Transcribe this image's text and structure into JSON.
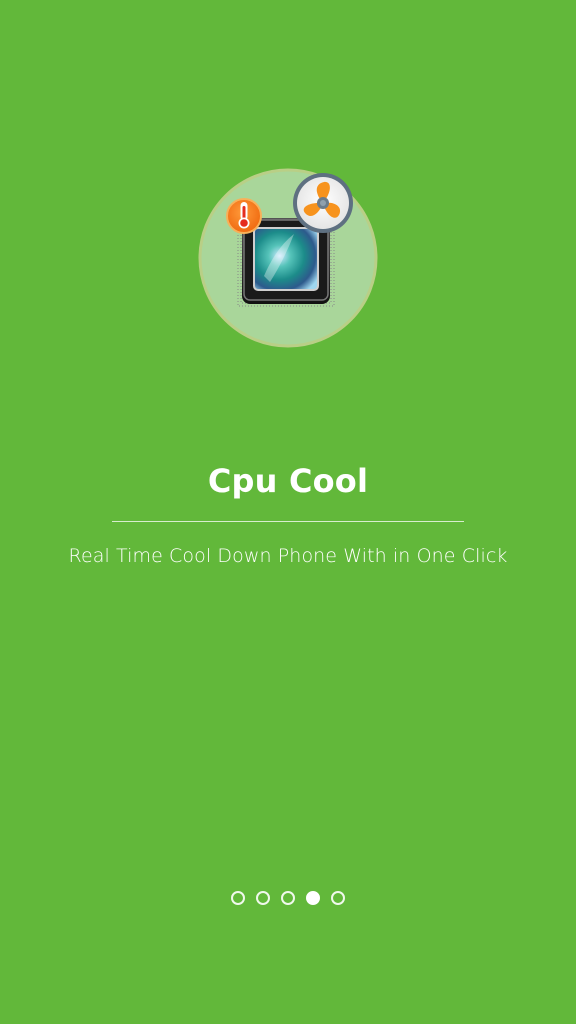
{
  "onboarding": {
    "title": "Cpu Cool",
    "subtitle": "Real Time Cool Down Phone With in One Click"
  },
  "hero": {
    "icons": [
      "cpu-chip-icon",
      "thermometer-icon",
      "fan-icon"
    ],
    "colors": {
      "background": "#62b83a",
      "circle": "#a9d69a",
      "fan_orange": "#f7931e",
      "thermo_red": "#e52d1f"
    }
  },
  "pager": {
    "total": 5,
    "current": 4
  }
}
